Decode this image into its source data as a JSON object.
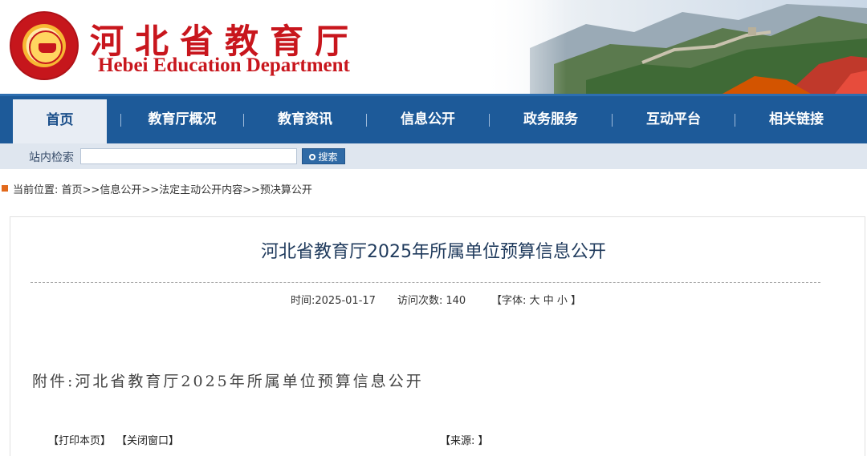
{
  "header": {
    "title_cn": "河北省教育厅",
    "title_en": "Hebei Education Department",
    "brand_color": "#c8161d"
  },
  "nav": {
    "items": [
      {
        "label": "首页",
        "active": true
      },
      {
        "label": "教育厅概况"
      },
      {
        "label": "教育资讯"
      },
      {
        "label": "信息公开"
      },
      {
        "label": "政务服务"
      },
      {
        "label": "互动平台"
      },
      {
        "label": "相关链接"
      }
    ],
    "bg_color": "#1d5a99"
  },
  "search": {
    "label": "站内检索",
    "value": "",
    "button_label": "搜索",
    "button_icon": "search-icon"
  },
  "breadcrumb": {
    "prefix": "当前位置:",
    "path": "首页>>信息公开>>法定主动公开内容>>预决算公开"
  },
  "article": {
    "title": "河北省教育厅2025年所属单位预算信息公开",
    "time_label": "时间:",
    "time_value": "2025-01-17",
    "visits_label": "访问次数:",
    "visits_value": "140",
    "font_size_open": "【字体:",
    "font_large": "大",
    "font_medium": "中",
    "font_small": "小",
    "font_size_close": "】",
    "attachment_text": "附件:河北省教育厅2025年所属单位预算信息公开"
  },
  "footer": {
    "print": "【打印本页】",
    "close": "【关闭窗口】",
    "source": "【来源: 】"
  }
}
